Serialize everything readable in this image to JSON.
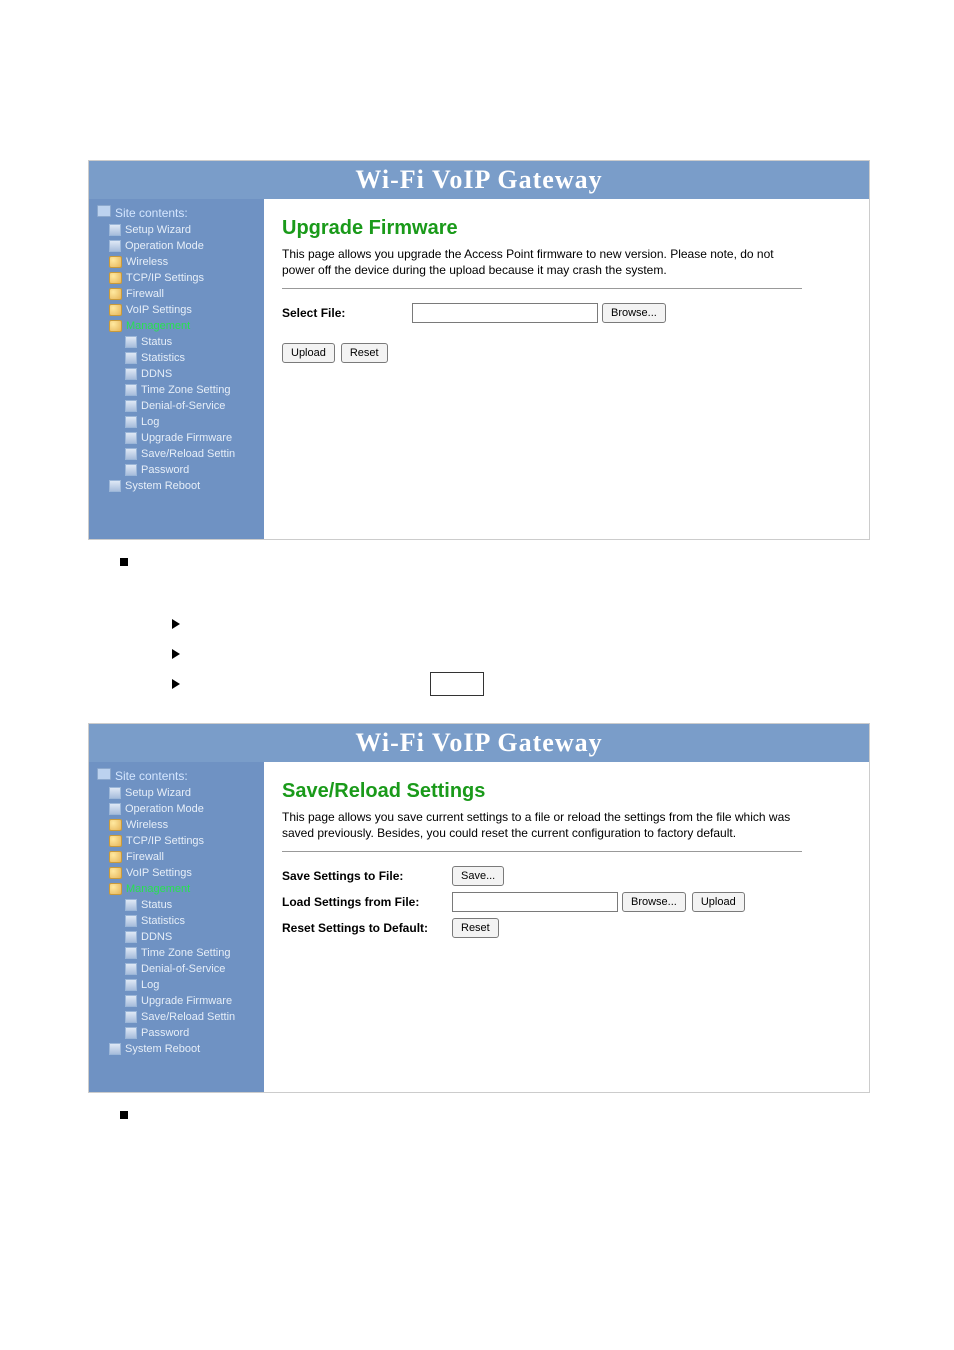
{
  "banner_title": "Wi-Fi  VoIP  Gateway",
  "sidebar": {
    "header": "Site contents:",
    "items": [
      {
        "label": "Setup Wizard",
        "type": "doc"
      },
      {
        "label": "Operation Mode",
        "type": "doc"
      },
      {
        "label": "Wireless",
        "type": "fld"
      },
      {
        "label": "TCP/IP Settings",
        "type": "fld"
      },
      {
        "label": "Firewall",
        "type": "fld"
      },
      {
        "label": "VoIP Settings",
        "type": "fld"
      },
      {
        "label": "Management",
        "type": "fld",
        "green": true
      },
      {
        "label": "Status",
        "type": "doc",
        "sub": true
      },
      {
        "label": "Statistics",
        "type": "doc",
        "sub": true
      },
      {
        "label": "DDNS",
        "type": "doc",
        "sub": true
      },
      {
        "label": "Time Zone Setting",
        "type": "doc",
        "sub": true
      },
      {
        "label": "Denial-of-Service",
        "type": "doc",
        "sub": true
      },
      {
        "label": "Log",
        "type": "doc",
        "sub": true
      },
      {
        "label": "Upgrade Firmware",
        "type": "doc",
        "sub": true
      },
      {
        "label": "Save/Reload Settin",
        "type": "doc",
        "sub": true
      },
      {
        "label": "Password",
        "type": "doc",
        "sub": true
      },
      {
        "label": "System Reboot",
        "type": "doc"
      }
    ]
  },
  "upgrade": {
    "title": "Upgrade Firmware",
    "desc": "This page allows you upgrade the Access Point firmware to new version. Please note, do not power off the device during the upload because it may crash the system.",
    "select_file_label": "Select File:",
    "browse_btn": "Browse...",
    "upload_btn": "Upload",
    "reset_btn": "Reset"
  },
  "save": {
    "title": "Save/Reload Settings",
    "desc": "This page allows you save current settings to a file or reload the settings from the file which was saved previously. Besides, you could reset the current configuration to factory default.",
    "save_label": "Save Settings to File:",
    "save_btn": "Save...",
    "load_label": "Load Settings from File:",
    "browse_btn": "Browse...",
    "upload_btn": "Upload",
    "reset_label": "Reset Settings to Default:",
    "reset_btn": "Reset"
  }
}
